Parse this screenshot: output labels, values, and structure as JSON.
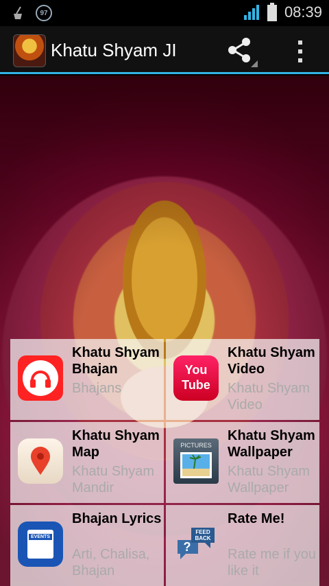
{
  "status_bar": {
    "time": "08:39",
    "notification_count": "97",
    "icons": [
      "cleaner-icon",
      "badge-icon",
      "signal-icon",
      "battery-icon"
    ]
  },
  "action_bar": {
    "title": "Khatu Shyam JI",
    "actions": [
      "share-icon",
      "overflow-menu-icon"
    ]
  },
  "tiles": [
    {
      "title": "Khatu Shyam Bhajan",
      "subtitle": "Bhajans",
      "icon": "headphones-icon"
    },
    {
      "title": "Khatu Shyam Video",
      "subtitle": "Khatu Shyam Video",
      "icon": "youtube-icon",
      "icon_text": "You Tube"
    },
    {
      "title": "Khatu Shyam Map",
      "subtitle": "Khatu Shyam Mandir",
      "icon": "map-pin-icon"
    },
    {
      "title": "Khatu Shyam Wallpaper",
      "subtitle": "Khatu Shyam Wallpaper",
      "icon": "pictures-icon",
      "icon_text": "PICTURES"
    },
    {
      "title": "Bhajan Lyrics",
      "subtitle": "Arti, Chalisa, Bhajan",
      "icon": "events-icon",
      "icon_text": "EVENTS"
    },
    {
      "title": "Rate Me!",
      "subtitle": "Rate me if you like it",
      "icon": "feedback-icon",
      "icon_text": "FEED BACK"
    }
  ],
  "colors": {
    "accent": "#33b5e5",
    "youtube": "#ee2255",
    "bhajan": "#ff2222",
    "events": "#1a55b5"
  }
}
